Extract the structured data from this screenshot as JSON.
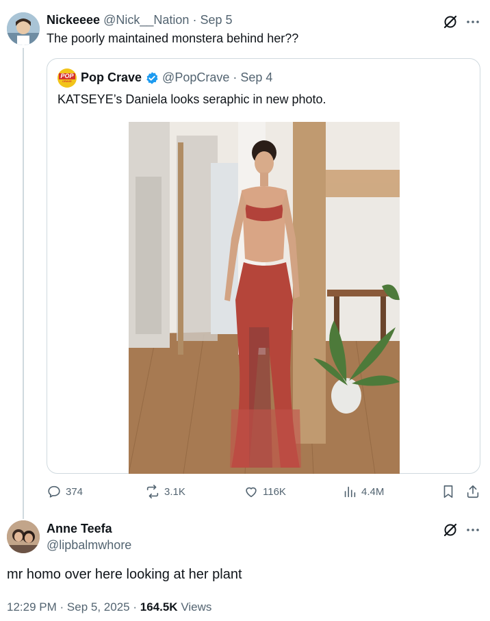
{
  "reply_tweet": {
    "author_name": "Nickeeee",
    "handle": "@Nick__Nation",
    "sep": "·",
    "date": "Sep 5",
    "text": "The poorly maintained monstera behind her??"
  },
  "quoted_tweet": {
    "author_name": "Pop Crave",
    "avatar_text_top": "POP",
    "avatar_text_bottom": "CRAVE",
    "handle": "@PopCrave",
    "sep": "·",
    "date": "Sep 4",
    "text": "KATSEYE’s Daniela looks seraphic in new photo."
  },
  "actions": {
    "replies": "374",
    "reposts": "3.1K",
    "likes": "116K",
    "views": "4.4M"
  },
  "main_tweet": {
    "author_name": "Anne Teefa",
    "handle": "@lipbalmwhore",
    "text": "mr homo over here looking at her plant",
    "time": "12:29 PM",
    "dot1": "·",
    "date": "Sep 5, 2025",
    "dot2": "·",
    "view_count": "164.5K",
    "views_label": "Views"
  },
  "icons": [
    "grok-icon",
    "more-icon",
    "verified-badge-icon",
    "reply-icon",
    "repost-icon",
    "like-icon",
    "analytics-icon",
    "bookmark-icon",
    "share-icon"
  ],
  "colors": {
    "verified_blue": "#1d9bf0",
    "muted": "#536471",
    "border": "#cfd9de",
    "pop_crave_yellow": "#f2c41a",
    "pop_crave_red": "#d6322c"
  }
}
